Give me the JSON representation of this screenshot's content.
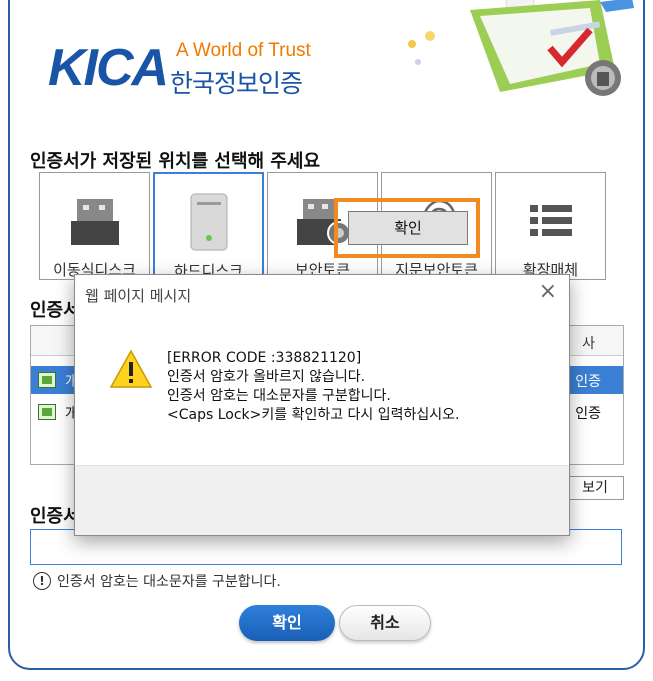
{
  "brand": {
    "logo_text": "KICA",
    "tagline": "A World of Trust",
    "korean_name": "한국정보인증"
  },
  "storage": {
    "title": "인증서가 저장된 위치를 선택해 주세요",
    "tiles": [
      {
        "label": "이동식디스크",
        "icon": "usb-drive-icon"
      },
      {
        "label": "하드디스크",
        "icon": "hard-disk-icon",
        "selected": true
      },
      {
        "label": "보안토큰",
        "icon": "security-token-icon"
      },
      {
        "label": "지문보안토큰",
        "icon": "fingerprint-icon"
      },
      {
        "label": "확장매체",
        "icon": "extended-media-icon"
      }
    ]
  },
  "cert_list": {
    "title": "인증서",
    "header_last_col": "사",
    "rows": [
      {
        "name": "개",
        "issuer": "인증",
        "selected": true
      },
      {
        "name": "개",
        "issuer": "인증",
        "selected": false
      }
    ],
    "view_button": "보기"
  },
  "password": {
    "title": "인증서",
    "hint": "인증서 암호는 대소문자를 구분합니다."
  },
  "actions": {
    "ok": "확인",
    "cancel": "취소"
  },
  "dialog": {
    "title": "웹 페이지 메시지",
    "close": "×",
    "lines": [
      "[ERROR CODE :338821120]",
      "인증서 암호가 올바르지 않습니다.",
      "인증서 암호는 대소문자를 구분합니다.",
      "<Caps Lock>키를 확인하고 다시 입력하십시오."
    ],
    "ok": "확인",
    "highlight_color": "#f28a24"
  },
  "colors": {
    "brand_blue": "#1a54a6",
    "brand_orange": "#f07a00",
    "selection_blue": "#3b7fd4"
  }
}
